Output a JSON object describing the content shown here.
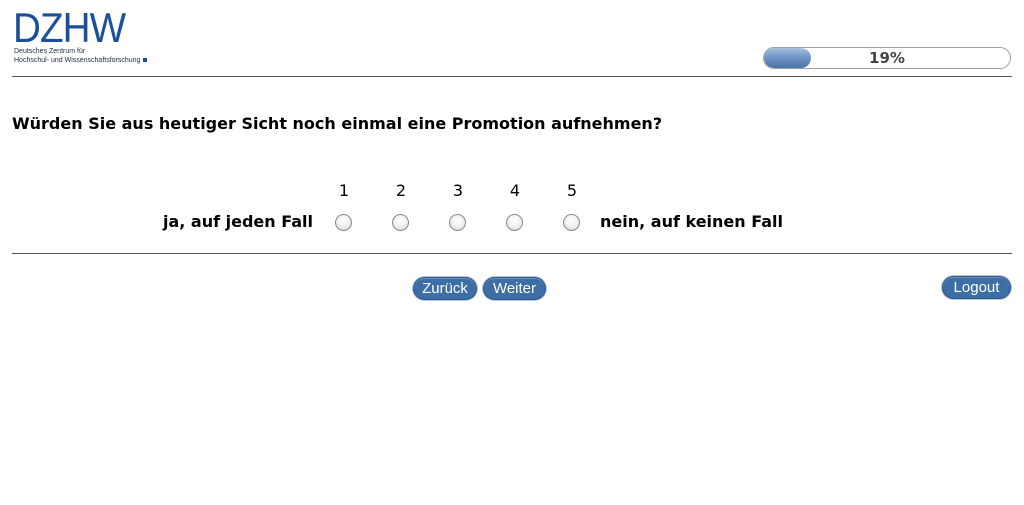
{
  "header": {
    "logo": {
      "mark": "DZHW",
      "line1": "Deutsches Zentrum für",
      "line2": "Hochschul- und Wissenschaftsforschung"
    },
    "progress": {
      "value": 0.19,
      "label": "19%"
    }
  },
  "question": {
    "text": "Würden Sie aus heutiger Sicht noch einmal eine Promotion aufnehmen?",
    "scale": [
      "1",
      "2",
      "3",
      "4",
      "5"
    ],
    "left_label": "ja, auf jeden Fall",
    "right_label": "nein, auf keinen Fall",
    "selected": null
  },
  "navigation": {
    "back_label": "Zurück",
    "next_label": "Weiter",
    "logout_label": "Logout"
  },
  "colors": {
    "brand": "#1a4f9c",
    "button": "#3d6ea5",
    "progress_fill": "#6f95c4"
  }
}
